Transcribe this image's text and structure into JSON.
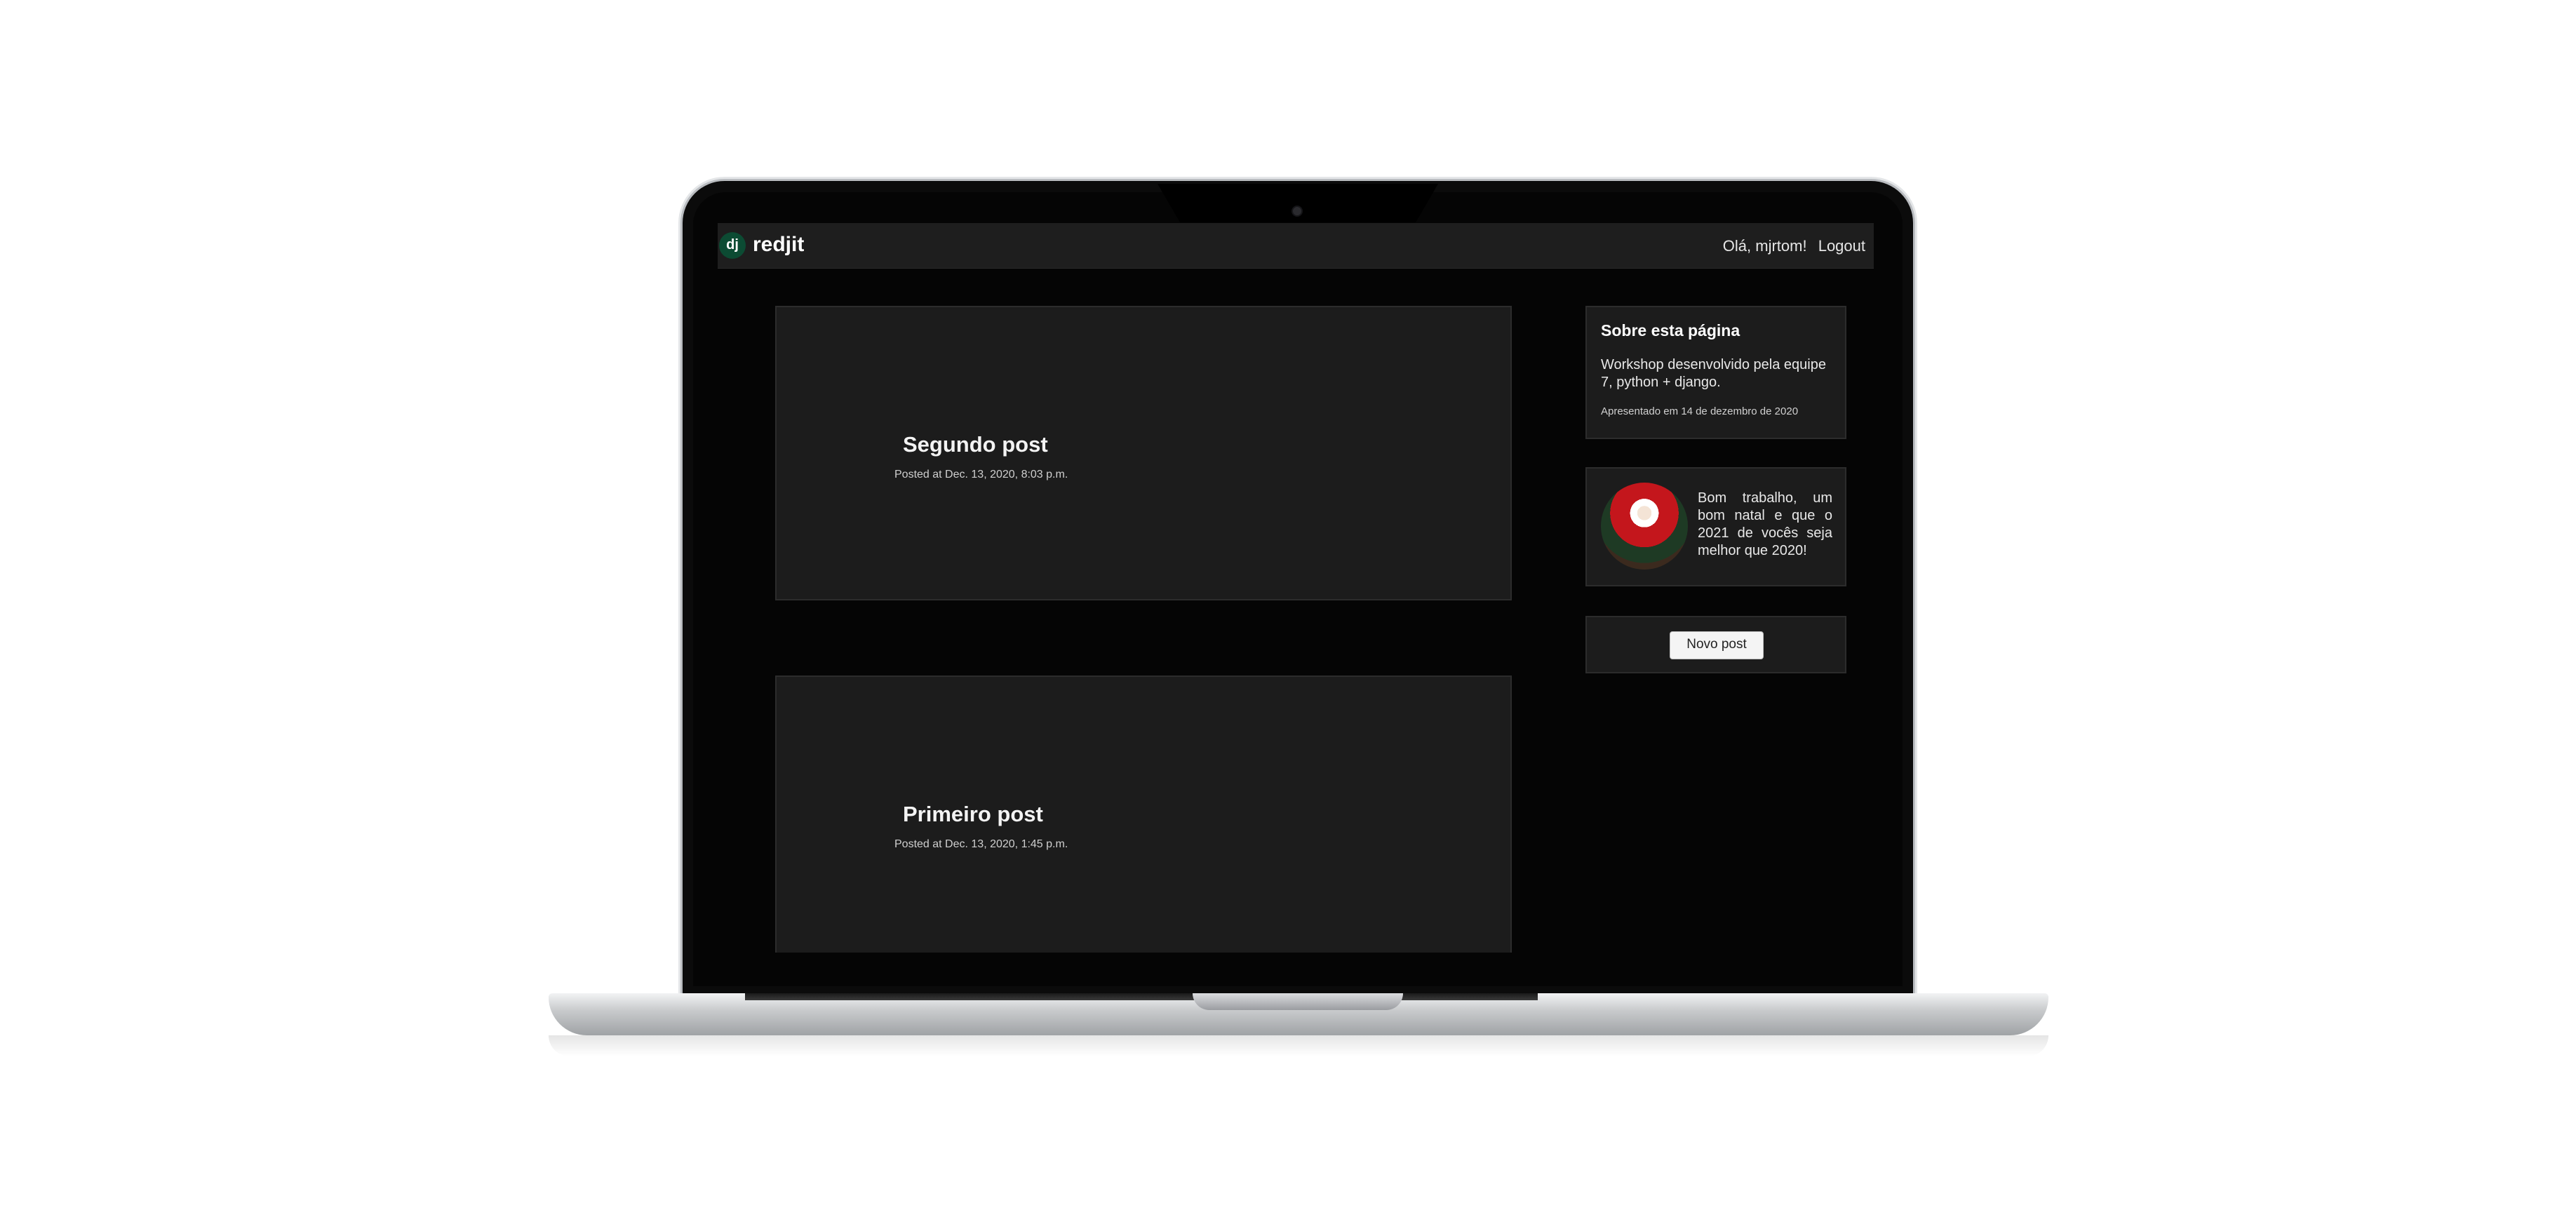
{
  "navbar": {
    "logo_text": "dj",
    "brand": "redjit",
    "greeting": "Olá, mjrtom!",
    "logout": "Logout"
  },
  "posts": [
    {
      "title": "Segundo post",
      "meta": "Posted at Dec. 13, 2020, 8:03 p.m."
    },
    {
      "title": "Primeiro post",
      "meta": "Posted at Dec. 13, 2020, 1:45 p.m."
    }
  ],
  "sidebar": {
    "about": {
      "title": "Sobre esta página",
      "text": "Workshop desenvolvido pela equipe 7, python + django.",
      "date": "Apresentado em 14 de dezembro de 2020"
    },
    "greeting_card": {
      "avatar": "santa-claus-image",
      "text": "Bom trabalho, um bom natal e que o 2021 de vocês seja melhor que 2020!"
    },
    "new_post_button": "Novo post"
  },
  "colors": {
    "page_background": "#050505",
    "card_background": "#1c1c1c",
    "navbar_background": "#1e1e1e",
    "django_green": "#0c4b33"
  }
}
